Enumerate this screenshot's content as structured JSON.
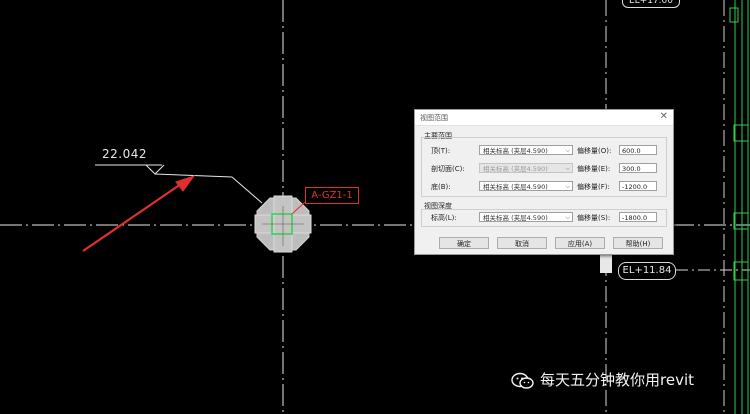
{
  "canvas": {
    "elevation_value": "22.042",
    "column_tag": "A-GZ1-1",
    "level_tag": "EL+11.84",
    "top_level_tag": "EL+17.00"
  },
  "dialog": {
    "title": "视图范围",
    "primary_group_label": "主要范围",
    "rows": [
      {
        "label": "顶(T):",
        "select": "相关标高 (夹层4.590)",
        "offset_label": "偏移量(O):",
        "offset_value": "600.0",
        "disabled": false
      },
      {
        "label": "剖切面(C):",
        "select": "相关标高 (夹层4.590)",
        "offset_label": "偏移量(E):",
        "offset_value": "300.0",
        "disabled": true
      },
      {
        "label": "底(B):",
        "select": "相关标高 (夹层4.590)",
        "offset_label": "偏移量(F):",
        "offset_value": "-1200.0",
        "disabled": false
      }
    ],
    "depth_group_label": "视图深度",
    "depth_row": {
      "label": "标高(L):",
      "select": "相关标高 (夹层4.590)",
      "offset_label": "偏移量(S):",
      "offset_value": "-1800.0"
    },
    "buttons": {
      "ok": "确定",
      "cancel": "取消",
      "apply": "应用(A)",
      "help": "帮助(H)"
    }
  },
  "watermark": {
    "text": "每天五分钟教你用revit"
  },
  "colors": {
    "background": "#000000",
    "annotation_red": "#e0302e",
    "column_green": "#2fd14a"
  }
}
